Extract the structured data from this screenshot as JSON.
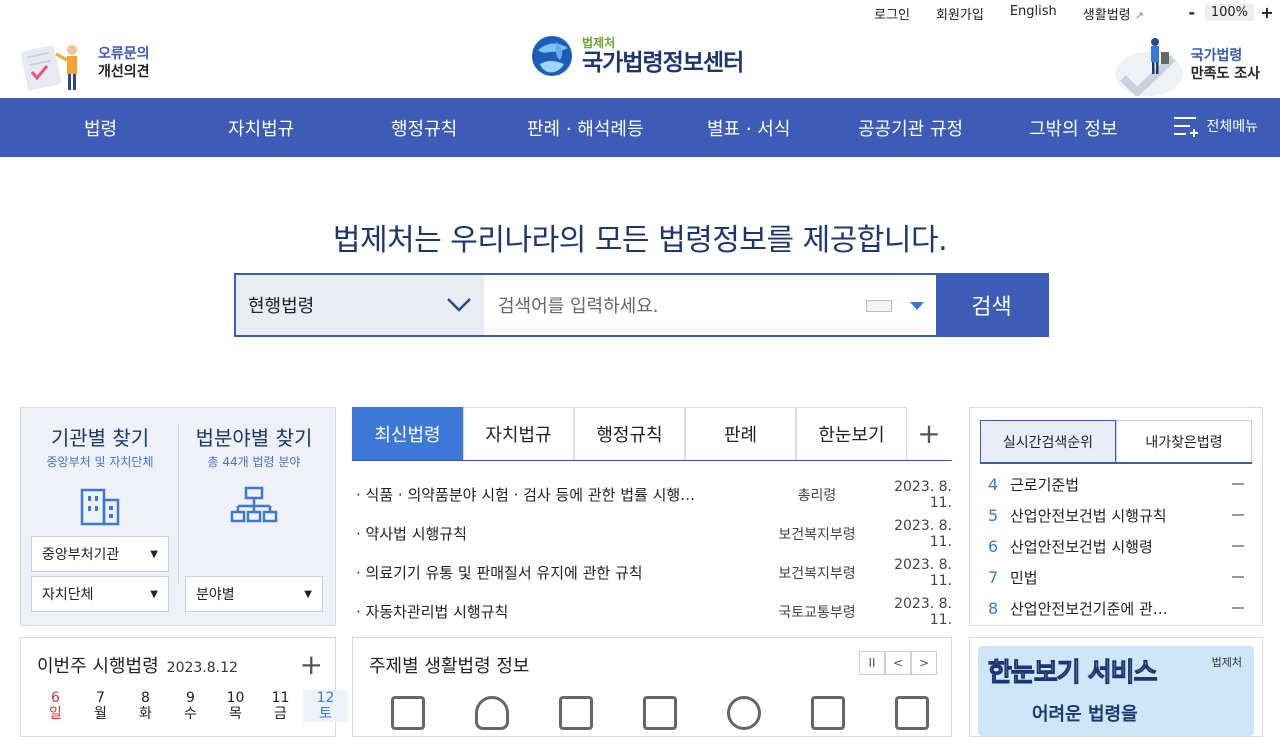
{
  "top": {
    "links": [
      "로그인",
      "회원가입",
      "English",
      "생활법령"
    ],
    "zoom_minus": "-",
    "zoom_value": "100%",
    "zoom_plus": "+"
  },
  "header": {
    "left_banner_line1": "오류문의",
    "left_banner_line2": "개선의견",
    "logo_sub": "법제처",
    "logo_main": "국가법령정보센터",
    "right_banner_line1": "국가법령",
    "right_banner_line2": "만족도 조사"
  },
  "nav": {
    "items": [
      "법령",
      "자치법규",
      "행정규칙",
      "판례 · 해석례등",
      "별표 · 서식",
      "공공기관 규정",
      "그밖의 정보"
    ],
    "all_menu": "전체메뉴"
  },
  "slogan": "법제처는 우리나라의 모든 법령정보를 제공합니다.",
  "search": {
    "select_value": "현행법령",
    "placeholder": "검색어를 입력하세요.",
    "button": "검색"
  },
  "find": {
    "agency_title": "기관별 찾기",
    "agency_sub": "중앙부처 및 자치단체",
    "field_title": "법분야별 찾기",
    "field_sub": "총 44개 법령 분야",
    "sel_central": "중앙부처기관",
    "sel_local": "자치단체",
    "sel_field": "분야별"
  },
  "tabs": {
    "items": [
      "최신법령",
      "자치법규",
      "행정규칙",
      "판례",
      "한눈보기"
    ],
    "plus": "+"
  },
  "laws": [
    {
      "name": "· 식품 · 의약품분야 시험 · 검사 등에 관한 법률 시행…",
      "dept": "총리령",
      "date": "2023. 8. 11."
    },
    {
      "name": "· 약사법 시행규칙",
      "dept": "보건복지부령",
      "date": "2023. 8. 11."
    },
    {
      "name": "· 의료기기 유통 및 판매질서 유지에 관한 규칙",
      "dept": "보건복지부령",
      "date": "2023. 8. 11."
    },
    {
      "name": "· 자동차관리법 시행규칙",
      "dept": "국토교통부령",
      "date": "2023. 8. 11."
    }
  ],
  "rank": {
    "tab_realtime": "실시간검색순위",
    "tab_mine": "내가찾은법령",
    "items": [
      {
        "num": "4",
        "name": "근로기준법"
      },
      {
        "num": "5",
        "name": "산업안전보건법 시행규칙"
      },
      {
        "num": "6",
        "name": "산업안전보건법 시행령"
      },
      {
        "num": "7",
        "name": "민법"
      },
      {
        "num": "8",
        "name": "산업안전보건기준에 관…"
      }
    ]
  },
  "week": {
    "title": "이번주 시행법령",
    "date": "2023.8.12",
    "plus": "+",
    "days": [
      {
        "n": "6",
        "w": "일"
      },
      {
        "n": "7",
        "w": "월"
      },
      {
        "n": "8",
        "w": "화"
      },
      {
        "n": "9",
        "w": "수"
      },
      {
        "n": "10",
        "w": "목"
      },
      {
        "n": "11",
        "w": "금"
      },
      {
        "n": "12",
        "w": "토"
      }
    ]
  },
  "topic": {
    "title": "주제별 생활법령 정보",
    "pause": "II",
    "prev": "<",
    "next": ">"
  },
  "promo": {
    "title": "한눈보기 서비스",
    "sub": "어려운 법령을",
    "mark": "법제처"
  }
}
